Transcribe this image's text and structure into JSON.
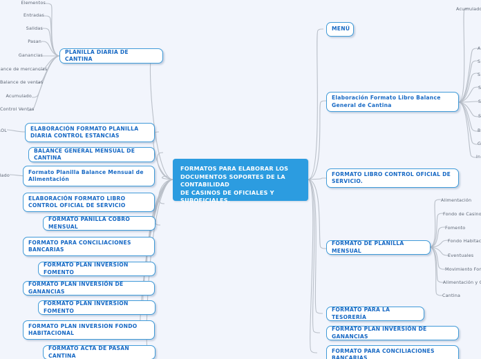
{
  "diagram": {
    "type": "mind-map",
    "background_color": "#f2f5fc",
    "node_fill": "#ffffff",
    "node_border_color": "#3f9ad8",
    "node_text_color": "#1668c4",
    "center_fill": "#2c9ce0",
    "center_text_color": "#ffffff",
    "link_color": "#b9bfc8"
  },
  "center": {
    "label": "FORMATOS PARA ELABORAR LOS DOCUMENTOS SOPORTES DE LA CONTABILIDAD\nDE CASINOS DE OFICIALES Y SUBOFICIALES."
  },
  "left_branches": [
    {
      "label": "PLANILLA DIARIA DE CANTINA"
    },
    {
      "label": "ELABORACIÓN FORMATO PLANILLA DIARIA CONTROL ESTANCIAS"
    },
    {
      "label": "BALANCE GENERAL MENSUAL DE CANTINA"
    },
    {
      "label": "Formato Planilla Balance Mensual de Alimentación"
    },
    {
      "label": "ELABORACIÓN FORMATO LIBRO CONTROL OFICIAL DE SERVICIO"
    },
    {
      "label": "FORMATO PANILLA COBRO MENSUAL"
    },
    {
      "label": "FORMATO PARA CONCILIACIONES BANCARIAS"
    },
    {
      "label": "FORMATO PLAN INVERSION FOMENTO"
    },
    {
      "label": "FORMATO PLAN INVERSIÓN DE GANANCIAS"
    },
    {
      "label": "FORMATO PLAN INVERSION FOMENTO"
    },
    {
      "label": "FORMATO PLAN INVERSION FONDO HABITACIONAL"
    },
    {
      "label": "FORMATO ACTA DE PASAN CANTINA"
    }
  ],
  "right_branches": [
    {
      "label": "MENÚ"
    },
    {
      "label": "Elaboración Formato Libro Balance General de Cantina"
    },
    {
      "label": "FORMATO LIBRO CONTROL OFICIAL DE SERVICIO."
    },
    {
      "label": "FORMATO DE PLANILLA MENSUAL"
    },
    {
      "label": "FORMATO PARA LA TESORERÍA"
    },
    {
      "label": "FORMATO PLAN INVERSIÓN DE GANANCIAS"
    },
    {
      "label": "FORMATO PARA CONCILIACIONES BANCARIAS"
    }
  ],
  "leaves_planilla_diaria": [
    {
      "label": "Elementos"
    },
    {
      "label": "Entradas"
    },
    {
      "label": "Salidas"
    },
    {
      "label": "Pasan"
    },
    {
      "label": "Ganancias"
    },
    {
      "label": "Balance de mercancías"
    },
    {
      "label": "Balance de ventas"
    },
    {
      "label": "Acumulado"
    },
    {
      "label": "Control Ventas"
    }
  ],
  "leaves_left_clipped": [
    {
      "label": "CONTROL"
    },
    {
      "label": "Acumulado"
    }
  ],
  "leaves_libro_balance": [
    {
      "label": "Acumulado"
    },
    {
      "label": "A"
    },
    {
      "label": "S"
    },
    {
      "label": "S"
    },
    {
      "label": "S"
    },
    {
      "label": "S"
    },
    {
      "label": "S"
    },
    {
      "label": "B"
    },
    {
      "label": "G"
    },
    {
      "label": "In"
    }
  ],
  "leaves_planilla_mensual": [
    {
      "label": "Alimentación"
    },
    {
      "label": "Fondo de Casino"
    },
    {
      "label": "Fomento"
    },
    {
      "label": "Fondo Habitacional"
    },
    {
      "label": "Eventuales"
    },
    {
      "label": "Movimiento Fondo"
    },
    {
      "label": "Alimentación y C"
    },
    {
      "label": "Cantina"
    }
  ]
}
